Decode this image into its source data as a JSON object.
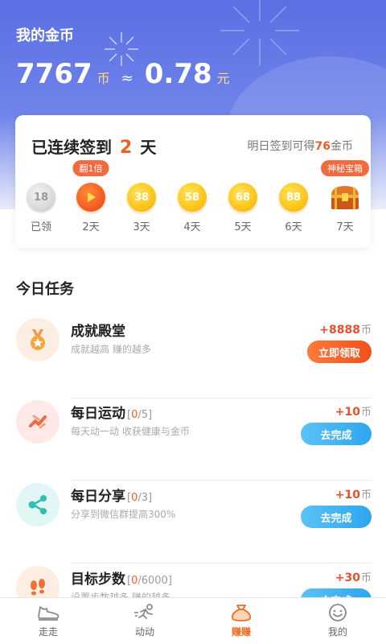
{
  "header": {
    "title": "我的金币",
    "coins": "7767",
    "coin_unit": "币",
    "approx": "≈",
    "money": "0.78",
    "money_unit": "元"
  },
  "signin": {
    "prefix": "已连续签到",
    "days": "2",
    "suffix": "天",
    "tomorrow_prefix": "明日签到可得",
    "tomorrow_amount": "76",
    "tomorrow_suffix": "金币",
    "items": [
      {
        "value": "18",
        "label": "已领",
        "state": "claimed"
      },
      {
        "value": "",
        "label": "2天",
        "state": "video",
        "tag": "翻1倍"
      },
      {
        "value": "38",
        "label": "3天",
        "state": "coin"
      },
      {
        "value": "58",
        "label": "4天",
        "state": "coin"
      },
      {
        "value": "68",
        "label": "5天",
        "state": "coin"
      },
      {
        "value": "88",
        "label": "6天",
        "state": "coin"
      },
      {
        "value": "",
        "label": "7天",
        "state": "chest",
        "tag": "神秘宝箱"
      }
    ]
  },
  "tasks_title": "今日任务",
  "tasks": [
    {
      "name": "成就殿堂",
      "progress_cur": "",
      "progress_total": "",
      "desc": "成就越高 赚的越多",
      "reward": "+8888",
      "reward_unit": "币",
      "button": "立即领取",
      "icon": "medal-icon"
    },
    {
      "name": "每日运动",
      "progress_cur": "0",
      "progress_total": "/5",
      "desc": "每天动一动 收获健康与金币",
      "reward": "+10",
      "reward_unit": "币",
      "button": "去完成",
      "icon": "running-icon"
    },
    {
      "name": "每日分享",
      "progress_cur": "0",
      "progress_total": "/3",
      "desc": "分享到微信群提高300%",
      "reward": "+10",
      "reward_unit": "币",
      "button": "去完成",
      "icon": "share-icon"
    },
    {
      "name": "目标步数",
      "progress_cur": "0",
      "progress_total": "/6000",
      "desc": "设置步数越多 赚的越多",
      "reward": "+30",
      "reward_unit": "币",
      "button": "去完成",
      "icon": "footprint-icon"
    }
  ],
  "tabs": [
    {
      "label": "走走",
      "icon": "shoe-icon",
      "active": false
    },
    {
      "label": "动动",
      "icon": "runner-icon",
      "active": false
    },
    {
      "label": "赚赚",
      "icon": "money-bag-icon",
      "active": true
    },
    {
      "label": "我的",
      "icon": "smiley-icon",
      "active": false
    }
  ],
  "colors": {
    "header_blue": "#5b6fe3",
    "accent_orange": "#f35c24",
    "button_blue": "#2ea6ef",
    "coin_gold": "#ffc51a"
  }
}
